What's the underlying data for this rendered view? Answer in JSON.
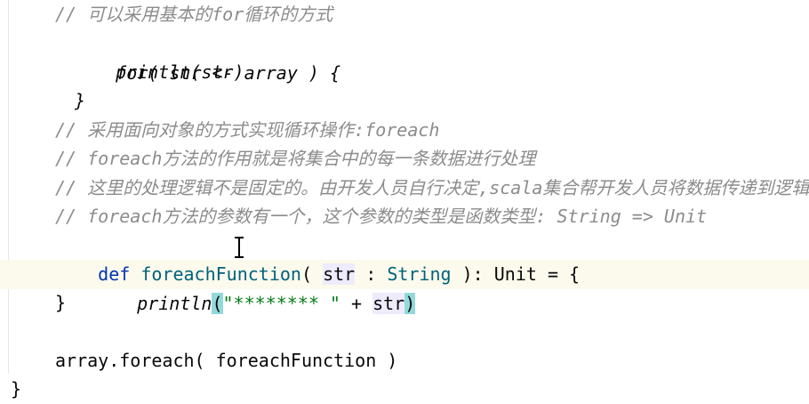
{
  "editor": {
    "lines": [
      {
        "id": "l1",
        "text": "// 可以采用基本的for循环的方式"
      },
      {
        "id": "l2",
        "text": "for( str <- array ) {"
      },
      {
        "id": "l3",
        "text": "println(str)"
      },
      {
        "id": "l4",
        "text": "}"
      },
      {
        "id": "l5",
        "text": "// 采用面向对象的方式实现循环操作:foreach"
      },
      {
        "id": "l6",
        "text": "// foreach方法的作用就是将集合中的每一条数据进行处理"
      },
      {
        "id": "l7",
        "text": "// 这里的处理逻辑不是固定的。由开发人员自行决定,scala集合帮开发人员将数据传递到逻辑"
      },
      {
        "id": "l8",
        "text": "// foreach方法的参数有一个，这个参数的类型是函数类型: String => Unit"
      },
      {
        "id": "l9",
        "parts": {
          "kw": "def",
          "name": "foreachFunction",
          "open": "( ",
          "param": "str",
          "colon": " : ",
          "ptype": "String",
          "rest": " ): ",
          "ret": "Unit",
          "eq": " = {"
        }
      },
      {
        "id": "l10",
        "parts": {
          "fn": "println",
          "lparen": "(",
          "strlit": "\"******** \"",
          "plus": " + ",
          "arg": "str",
          "rparen": ")"
        }
      },
      {
        "id": "l11",
        "text": "}"
      },
      {
        "id": "l12",
        "text": "array.foreach( foreachFunction )"
      },
      {
        "id": "l13",
        "text": "}"
      }
    ]
  },
  "colors": {
    "comment": "#8c8c8c",
    "keyword": "#0033b3",
    "function_decl": "#00627a",
    "string": "#067d17",
    "current_line": "#fcfaed",
    "brace_match": "#93d9d9",
    "param_highlight": "#edebfc"
  }
}
